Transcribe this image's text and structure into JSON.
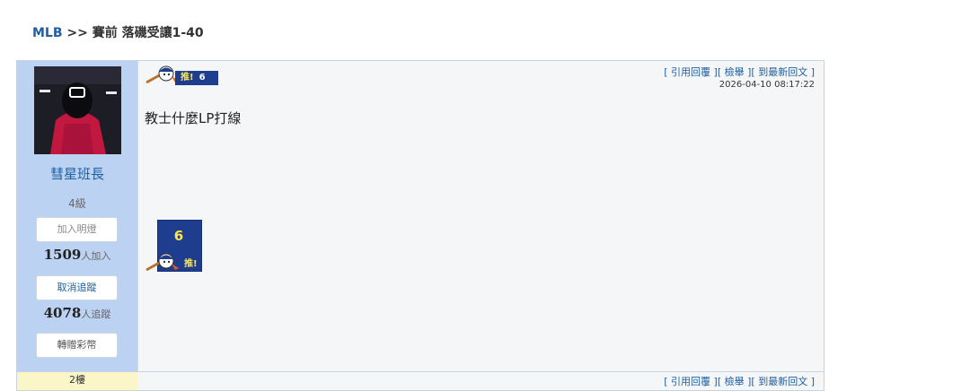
{
  "breadcrumb": {
    "link": "MLB",
    "sep": " >> ",
    "title": "賽前 落磯受讓1-40"
  },
  "post": {
    "user": {
      "name": "彗星班長",
      "level": "4級",
      "follow_light_btn": "加入明燈",
      "light_count": "1509",
      "light_suffix": "人加入",
      "unfollow_btn": "取消追蹤",
      "follow_count": "4078",
      "follow_suffix": "人追蹤",
      "gift_btn": "轉贈彩幣"
    },
    "push_badge": {
      "label": "推!",
      "count": "6"
    },
    "actions": {
      "quote": "[ 引用回覆 ]",
      "report": "[ 檢舉 ]",
      "latest": "[ 到最新回文 ]"
    },
    "timestamp": "2026-04-10 08:17:22",
    "body": "教士什麼LP打線",
    "push_button": {
      "count": "6",
      "label": "推!"
    }
  },
  "next_post": {
    "floor": "2樓",
    "actions": "[ 引用回覆 ][ 檢舉 ][ 到最新回文 ]"
  },
  "colors": {
    "link": "#1f5fa0",
    "sidebar": "#bcd2f3",
    "badge": "#1f3d8f"
  }
}
